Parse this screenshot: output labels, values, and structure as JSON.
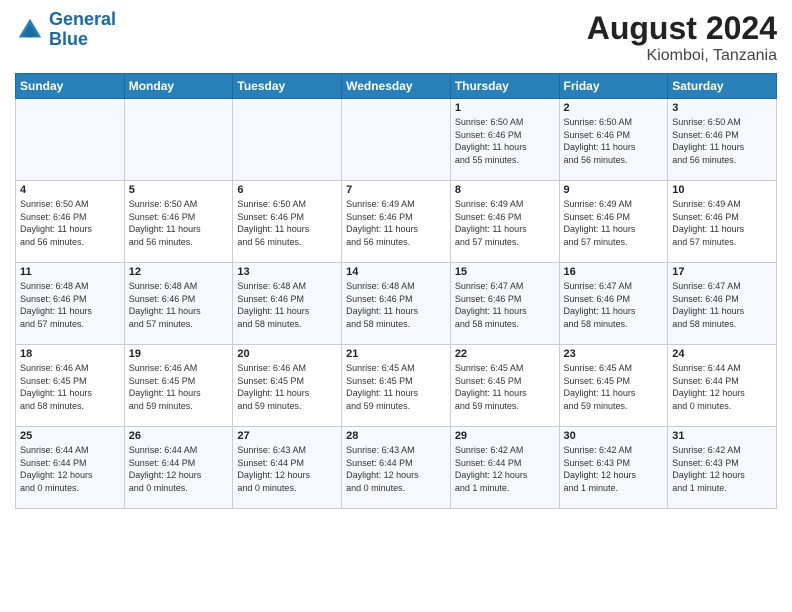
{
  "header": {
    "logo_line1": "General",
    "logo_line2": "Blue",
    "month_year": "August 2024",
    "location": "Kiomboi, Tanzania"
  },
  "weekdays": [
    "Sunday",
    "Monday",
    "Tuesday",
    "Wednesday",
    "Thursday",
    "Friday",
    "Saturday"
  ],
  "weeks": [
    [
      {
        "day": "",
        "info": ""
      },
      {
        "day": "",
        "info": ""
      },
      {
        "day": "",
        "info": ""
      },
      {
        "day": "",
        "info": ""
      },
      {
        "day": "1",
        "info": "Sunrise: 6:50 AM\nSunset: 6:46 PM\nDaylight: 11 hours\nand 55 minutes."
      },
      {
        "day": "2",
        "info": "Sunrise: 6:50 AM\nSunset: 6:46 PM\nDaylight: 11 hours\nand 56 minutes."
      },
      {
        "day": "3",
        "info": "Sunrise: 6:50 AM\nSunset: 6:46 PM\nDaylight: 11 hours\nand 56 minutes."
      }
    ],
    [
      {
        "day": "4",
        "info": "Sunrise: 6:50 AM\nSunset: 6:46 PM\nDaylight: 11 hours\nand 56 minutes."
      },
      {
        "day": "5",
        "info": "Sunrise: 6:50 AM\nSunset: 6:46 PM\nDaylight: 11 hours\nand 56 minutes."
      },
      {
        "day": "6",
        "info": "Sunrise: 6:50 AM\nSunset: 6:46 PM\nDaylight: 11 hours\nand 56 minutes."
      },
      {
        "day": "7",
        "info": "Sunrise: 6:49 AM\nSunset: 6:46 PM\nDaylight: 11 hours\nand 56 minutes."
      },
      {
        "day": "8",
        "info": "Sunrise: 6:49 AM\nSunset: 6:46 PM\nDaylight: 11 hours\nand 57 minutes."
      },
      {
        "day": "9",
        "info": "Sunrise: 6:49 AM\nSunset: 6:46 PM\nDaylight: 11 hours\nand 57 minutes."
      },
      {
        "day": "10",
        "info": "Sunrise: 6:49 AM\nSunset: 6:46 PM\nDaylight: 11 hours\nand 57 minutes."
      }
    ],
    [
      {
        "day": "11",
        "info": "Sunrise: 6:48 AM\nSunset: 6:46 PM\nDaylight: 11 hours\nand 57 minutes."
      },
      {
        "day": "12",
        "info": "Sunrise: 6:48 AM\nSunset: 6:46 PM\nDaylight: 11 hours\nand 57 minutes."
      },
      {
        "day": "13",
        "info": "Sunrise: 6:48 AM\nSunset: 6:46 PM\nDaylight: 11 hours\nand 58 minutes."
      },
      {
        "day": "14",
        "info": "Sunrise: 6:48 AM\nSunset: 6:46 PM\nDaylight: 11 hours\nand 58 minutes."
      },
      {
        "day": "15",
        "info": "Sunrise: 6:47 AM\nSunset: 6:46 PM\nDaylight: 11 hours\nand 58 minutes."
      },
      {
        "day": "16",
        "info": "Sunrise: 6:47 AM\nSunset: 6:46 PM\nDaylight: 11 hours\nand 58 minutes."
      },
      {
        "day": "17",
        "info": "Sunrise: 6:47 AM\nSunset: 6:46 PM\nDaylight: 11 hours\nand 58 minutes."
      }
    ],
    [
      {
        "day": "18",
        "info": "Sunrise: 6:46 AM\nSunset: 6:45 PM\nDaylight: 11 hours\nand 58 minutes."
      },
      {
        "day": "19",
        "info": "Sunrise: 6:46 AM\nSunset: 6:45 PM\nDaylight: 11 hours\nand 59 minutes."
      },
      {
        "day": "20",
        "info": "Sunrise: 6:46 AM\nSunset: 6:45 PM\nDaylight: 11 hours\nand 59 minutes."
      },
      {
        "day": "21",
        "info": "Sunrise: 6:45 AM\nSunset: 6:45 PM\nDaylight: 11 hours\nand 59 minutes."
      },
      {
        "day": "22",
        "info": "Sunrise: 6:45 AM\nSunset: 6:45 PM\nDaylight: 11 hours\nand 59 minutes."
      },
      {
        "day": "23",
        "info": "Sunrise: 6:45 AM\nSunset: 6:45 PM\nDaylight: 11 hours\nand 59 minutes."
      },
      {
        "day": "24",
        "info": "Sunrise: 6:44 AM\nSunset: 6:44 PM\nDaylight: 12 hours\nand 0 minutes."
      }
    ],
    [
      {
        "day": "25",
        "info": "Sunrise: 6:44 AM\nSunset: 6:44 PM\nDaylight: 12 hours\nand 0 minutes."
      },
      {
        "day": "26",
        "info": "Sunrise: 6:44 AM\nSunset: 6:44 PM\nDaylight: 12 hours\nand 0 minutes."
      },
      {
        "day": "27",
        "info": "Sunrise: 6:43 AM\nSunset: 6:44 PM\nDaylight: 12 hours\nand 0 minutes."
      },
      {
        "day": "28",
        "info": "Sunrise: 6:43 AM\nSunset: 6:44 PM\nDaylight: 12 hours\nand 0 minutes."
      },
      {
        "day": "29",
        "info": "Sunrise: 6:42 AM\nSunset: 6:44 PM\nDaylight: 12 hours\nand 1 minute."
      },
      {
        "day": "30",
        "info": "Sunrise: 6:42 AM\nSunset: 6:43 PM\nDaylight: 12 hours\nand 1 minute."
      },
      {
        "day": "31",
        "info": "Sunrise: 6:42 AM\nSunset: 6:43 PM\nDaylight: 12 hours\nand 1 minute."
      }
    ]
  ]
}
